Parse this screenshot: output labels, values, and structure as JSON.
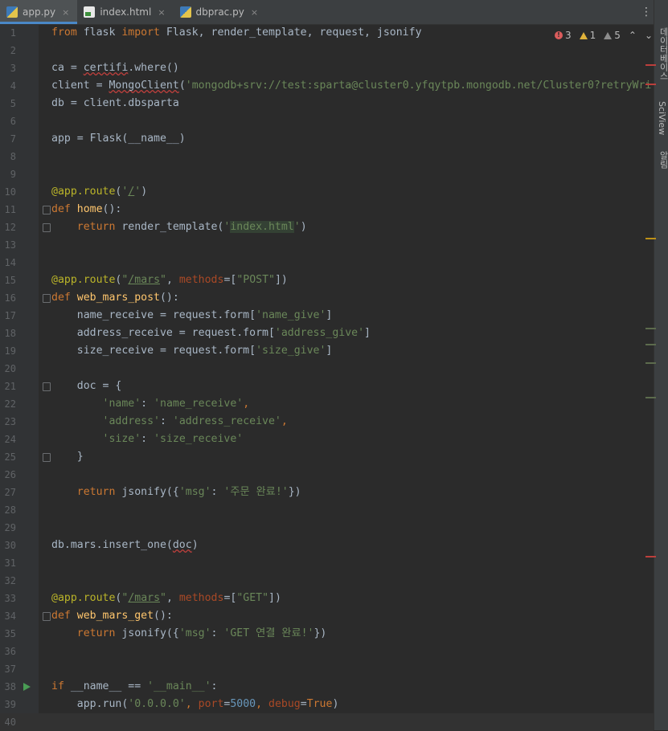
{
  "tabs": [
    {
      "label": "app.py",
      "icon": "python-file-icon",
      "active": true
    },
    {
      "label": "index.html",
      "icon": "html-file-icon",
      "active": false
    },
    {
      "label": "dbprac.py",
      "icon": "python-file-icon",
      "active": false
    }
  ],
  "tab_close_glyph": "×",
  "tab_menu_glyph": "⋮",
  "inspections": {
    "errors": "3",
    "warnings": "1",
    "weak_warnings": "5",
    "error_glyph": "!",
    "up": "⌃",
    "down": "⌄"
  },
  "right_strip": {
    "item1": "데이터베이스",
    "item2": "SciView",
    "item3": "알림"
  },
  "colors": {
    "keyword": "#cc7832",
    "string": "#6a8759",
    "decorator": "#bbb529",
    "function": "#ffc66d",
    "number": "#6897bb",
    "error": "#db5c5c",
    "warning": "#e0b23a"
  },
  "line_numbers": [
    "1",
    "2",
    "3",
    "4",
    "5",
    "6",
    "7",
    "8",
    "9",
    "10",
    "11",
    "12",
    "13",
    "14",
    "15",
    "16",
    "17",
    "18",
    "19",
    "20",
    "21",
    "22",
    "23",
    "24",
    "25",
    "26",
    "27",
    "28",
    "29",
    "30",
    "31",
    "32",
    "33",
    "34",
    "35",
    "36",
    "37",
    "38",
    "39",
    "40"
  ],
  "code": {
    "l1": {
      "from": "from",
      "mod": " flask ",
      "import": "import",
      "rest": " Flask, render_template, request, jsonify"
    },
    "l3": {
      "a": "ca = ",
      "b": "certifi",
      "c": ".where()"
    },
    "l4": {
      "a": "client = ",
      "b": "MongoClient",
      "c": "(",
      "d": "'mongodb+srv://test:sparta@cluster0.yfqytpb.mongodb.net/Cluster0?retryWri"
    },
    "l5": {
      "a": "db = client.dbsparta"
    },
    "l7": {
      "a": "app = Flask(__name__)"
    },
    "l10": {
      "a": "@app.route",
      "b": "(",
      "c": "'",
      "d": "/",
      "e": "'",
      "f": ")"
    },
    "l11": {
      "a": "def ",
      "b": "home",
      "c": "():"
    },
    "l12": {
      "a": "    ",
      "b": "return ",
      "c": "render_template(",
      "d": "'",
      "e": "index.html",
      "f": "'",
      "g": ")"
    },
    "l15": {
      "a": "@app.route",
      "b": "(",
      "c": "\"",
      "d": "/mars",
      "e": "\"",
      "f": ", ",
      "g": "methods",
      "h": "=[",
      "i": "\"POST\"",
      "j": "])"
    },
    "l16": {
      "a": "def ",
      "b": "web_mars_post",
      "c": "():"
    },
    "l17": {
      "a": "    name_receive = request.form[",
      "b": "'name_give'",
      "c": "]"
    },
    "l18": {
      "a": "    address_receive = request.form[",
      "b": "'address_give'",
      "c": "]"
    },
    "l19": {
      "a": "    size_receive = request.form[",
      "b": "'size_give'",
      "c": "]"
    },
    "l21": {
      "a": "    doc = {"
    },
    "l22": {
      "a": "        ",
      "b": "'name'",
      "c": ": ",
      "d": "'name_receive'",
      "e": ","
    },
    "l23": {
      "a": "        ",
      "b": "'address'",
      "c": ": ",
      "d": "'address_receive'",
      "e": ","
    },
    "l24": {
      "a": "        ",
      "b": "'size'",
      "c": ": ",
      "d": "'size_receive'"
    },
    "l25": {
      "a": "    }"
    },
    "l27": {
      "a": "    ",
      "b": "return ",
      "c": "jsonify({",
      "d": "'msg'",
      "e": ": ",
      "f": "'주문 완료!'",
      "g": "})"
    },
    "l30": {
      "a": "db.mars.insert_one(",
      "b": "doc",
      "c": ")"
    },
    "l33": {
      "a": "@app.route",
      "b": "(",
      "c": "\"",
      "d": "/mars",
      "e": "\"",
      "f": ", ",
      "g": "methods",
      "h": "=[",
      "i": "\"GET\"",
      "j": "])"
    },
    "l34": {
      "a": "def ",
      "b": "web_mars_get",
      "c": "():"
    },
    "l35": {
      "a": "    ",
      "b": "return ",
      "c": "jsonify({",
      "d": "'msg'",
      "e": ": ",
      "f": "'GET 연결 완료!'",
      "g": "})"
    },
    "l38": {
      "a": "if ",
      "b": "__name__ == ",
      "c": "'__main__'",
      "d": ":"
    },
    "l39": {
      "a": "    app.run(",
      "b": "'0.0.0.0'",
      "c": ", ",
      "d": "port",
      "e": "=",
      "f": "5000",
      "g": ", ",
      "h": "debug",
      "i": "=",
      "j": "True",
      "k": ")"
    }
  }
}
